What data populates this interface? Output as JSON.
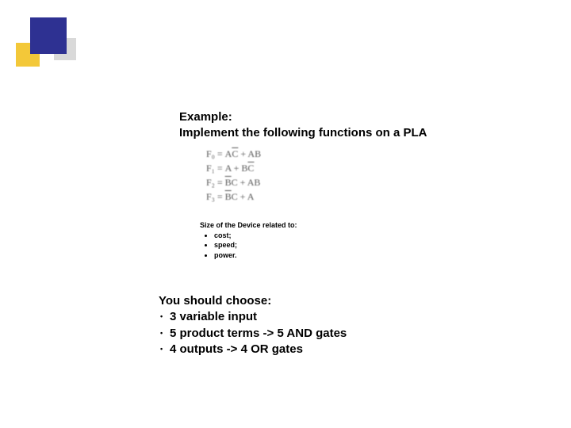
{
  "title": {
    "line1": "Example:",
    "line2": "Implement the following functions on a PLA"
  },
  "equations": {
    "f0": {
      "lhs": "F₀",
      "rhs_html": "A<span class='ov'>C</span> + AB"
    },
    "f1": {
      "lhs": "F₁",
      "rhs_html": "A + B<span class='ov'>C</span>"
    },
    "f2": {
      "lhs": "F₂",
      "rhs_html": "<span class='ov'>B</span>C + AB"
    },
    "f3": {
      "lhs": "F₃",
      "rhs_html": "<span class='ov'>B</span>C + A"
    }
  },
  "size": {
    "heading": "Size of the Device related to:",
    "items": [
      "cost;",
      "speed;",
      "power."
    ]
  },
  "choose": {
    "heading": "You should choose:",
    "items": [
      "3 variable input",
      "5 product terms -> 5 AND gates",
      "4 outputs -> 4 OR gates"
    ]
  }
}
